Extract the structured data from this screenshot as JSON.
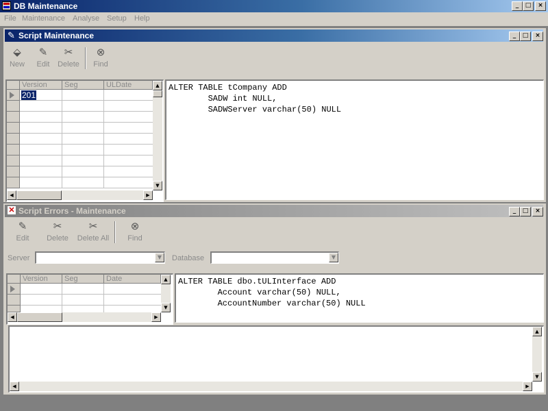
{
  "app": {
    "title": "DB Maintenance"
  },
  "window_buttons": {
    "minimize": "_",
    "maximize": "□",
    "close": "×"
  },
  "menu": [
    "File",
    "Maintenance",
    "Analyse",
    "Setup",
    "Help"
  ],
  "script_maintenance": {
    "title": "Script Maintenance",
    "toolbar": {
      "new": "New",
      "edit": "Edit",
      "delete": "Delete",
      "find": "Find"
    },
    "grid": {
      "columns": [
        "Version",
        "Seg",
        "ULDate"
      ],
      "rows": [
        [
          "201",
          "",
          ""
        ]
      ]
    },
    "script_text": "ALTER TABLE tCompany ADD\n        SADW int NULL,\n        SADWServer varchar(50) NULL"
  },
  "script_errors": {
    "title": "Script Errors - Maintenance",
    "toolbar": {
      "edit": "Edit",
      "delete": "Delete",
      "delete_all": "Delete All",
      "find": "Find"
    },
    "server_label": "Server",
    "database_label": "Database",
    "grid": {
      "columns": [
        "Version",
        "Seg",
        "Date"
      ]
    },
    "script_text": "ALTER TABLE dbo.tULInterface ADD\n        Account varchar(50) NULL,\n        AccountNumber varchar(50) NULL",
    "error_text": ""
  },
  "icons": {
    "app": "database-icon",
    "new": "new-document-icon",
    "edit": "edit-pencil-icon",
    "delete": "delete-icon",
    "delete_all": "delete-all-icon",
    "find": "binoculars-icon"
  }
}
